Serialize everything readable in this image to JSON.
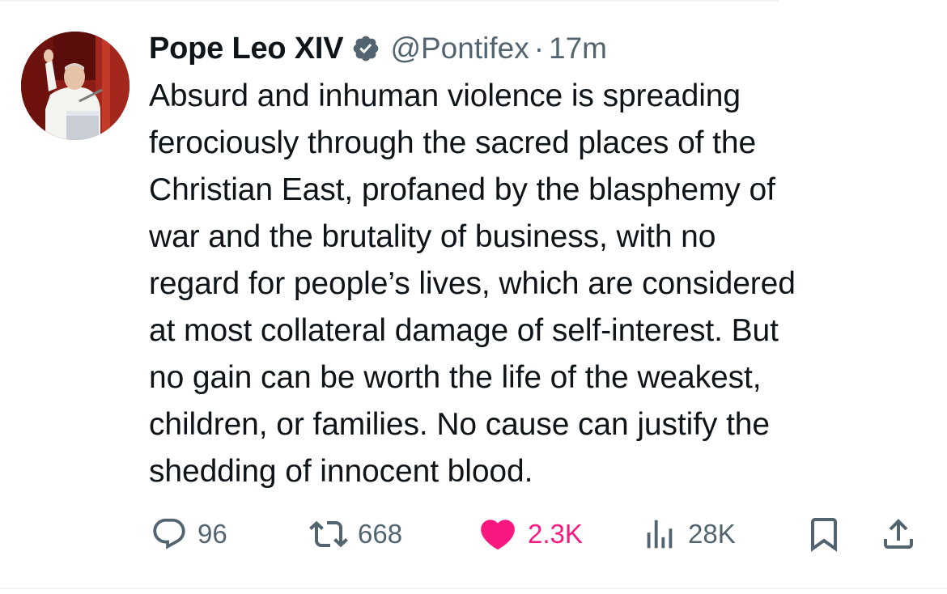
{
  "tweet": {
    "display_name": "Pope Leo XIV",
    "handle": "@Pontifex",
    "separator": "·",
    "time": "17m",
    "verified_icon": "verified-badge-icon",
    "text": "Absurd and inhuman violence is spreading\nferociously through the sacred places of the\nChristian East, profaned by the blasphemy of\nwar and the brutality of business, with no\nregard for people’s lives, which are considered\nat most collateral damage of self-interest. But\nno gain can be worth the life of the weakest,\nchildren, or families. No cause can justify the\nshedding of innocent blood."
  },
  "actions": {
    "replies": "96",
    "reposts": "668",
    "likes": "2.3K",
    "views": "28K"
  },
  "icons": {
    "reply": "reply-icon",
    "repost": "repost-icon",
    "like": "heart-icon",
    "views": "views-icon",
    "bookmark": "bookmark-icon",
    "share": "share-icon"
  },
  "colors": {
    "text": "#0f1419",
    "secondary": "#536471",
    "like": "#f91880",
    "verified_badge": "#536471"
  }
}
